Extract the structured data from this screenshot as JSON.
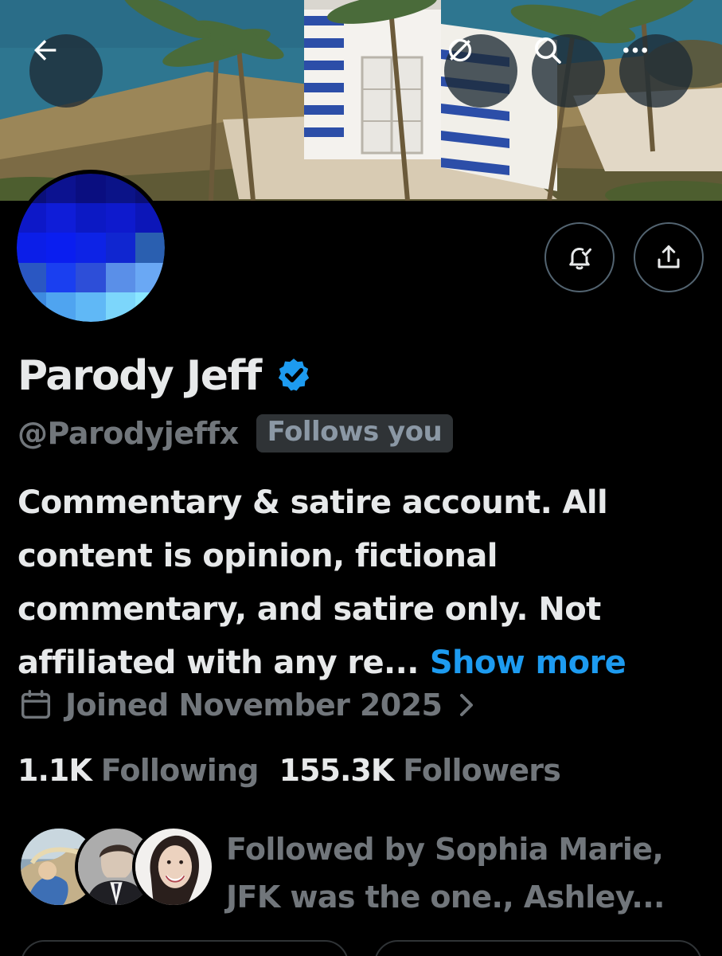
{
  "header": {
    "back_icon": "arrow-left-icon",
    "grok_icon": "grok-icon",
    "search_icon": "search-icon",
    "more_icon": "more-horizontal-icon"
  },
  "actions": {
    "notify_icon": "bell-check-icon",
    "share_icon": "share-icon"
  },
  "profile": {
    "display_name": "Parody Jeff",
    "verified_icon": "verified-badge-icon",
    "handle": "@Parodyjeffx",
    "follows_you": "Follows you",
    "bio_lines": [
      "Commentary & satire account. All",
      "content is opinion, fictional",
      "commentary, and satire only. Not",
      "affiliated with any re..."
    ],
    "show_more": "Show more",
    "joined": "Joined November 2025"
  },
  "stats": {
    "following_count": "1.1K",
    "following_label": "Following",
    "followers_count": "155.3K",
    "followers_label": "Followers"
  },
  "followed_by": {
    "lines": [
      "Followed by Sophia Marie,",
      "JFK was the one., Ashley..."
    ]
  },
  "colors": {
    "background": "#000000",
    "text_primary": "#e7e9ea",
    "text_secondary": "#71767b",
    "accent": "#1d9bf0",
    "verified": "#1d9bf0",
    "border": "#536471"
  }
}
